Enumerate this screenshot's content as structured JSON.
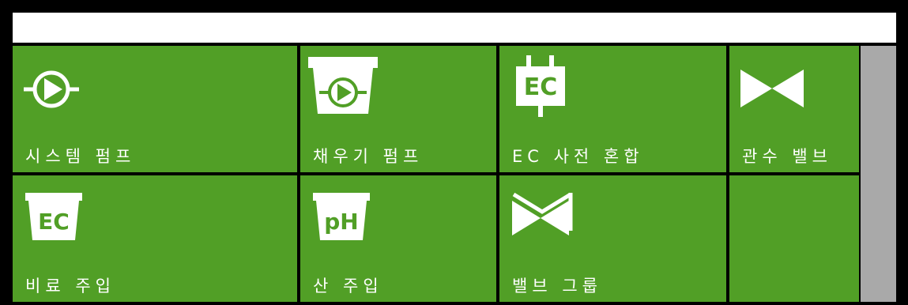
{
  "tiles": [
    {
      "label": "시스템 펌프",
      "icon": "pump-icon"
    },
    {
      "label": "채우기 펌프",
      "icon": "fill-pump-icon"
    },
    {
      "label": "EC 사전 혼합",
      "icon": "ec-premix-icon"
    },
    {
      "label": "관수 밸브",
      "icon": "valve-icon"
    },
    {
      "label": "비료 주입",
      "icon": "ec-tank-icon",
      "badge": "EC"
    },
    {
      "label": "산 주입",
      "icon": "ph-tank-icon",
      "badge": "pH"
    },
    {
      "label": "밸브 그룹",
      "icon": "valve-group-icon"
    },
    {
      "label": "",
      "icon": ""
    }
  ],
  "ec_premix_badge": "EC",
  "colors": {
    "tile": "#519f26",
    "scrollbar": "#a9a9a9",
    "background": "#000000",
    "topbar": "#ffffff"
  }
}
